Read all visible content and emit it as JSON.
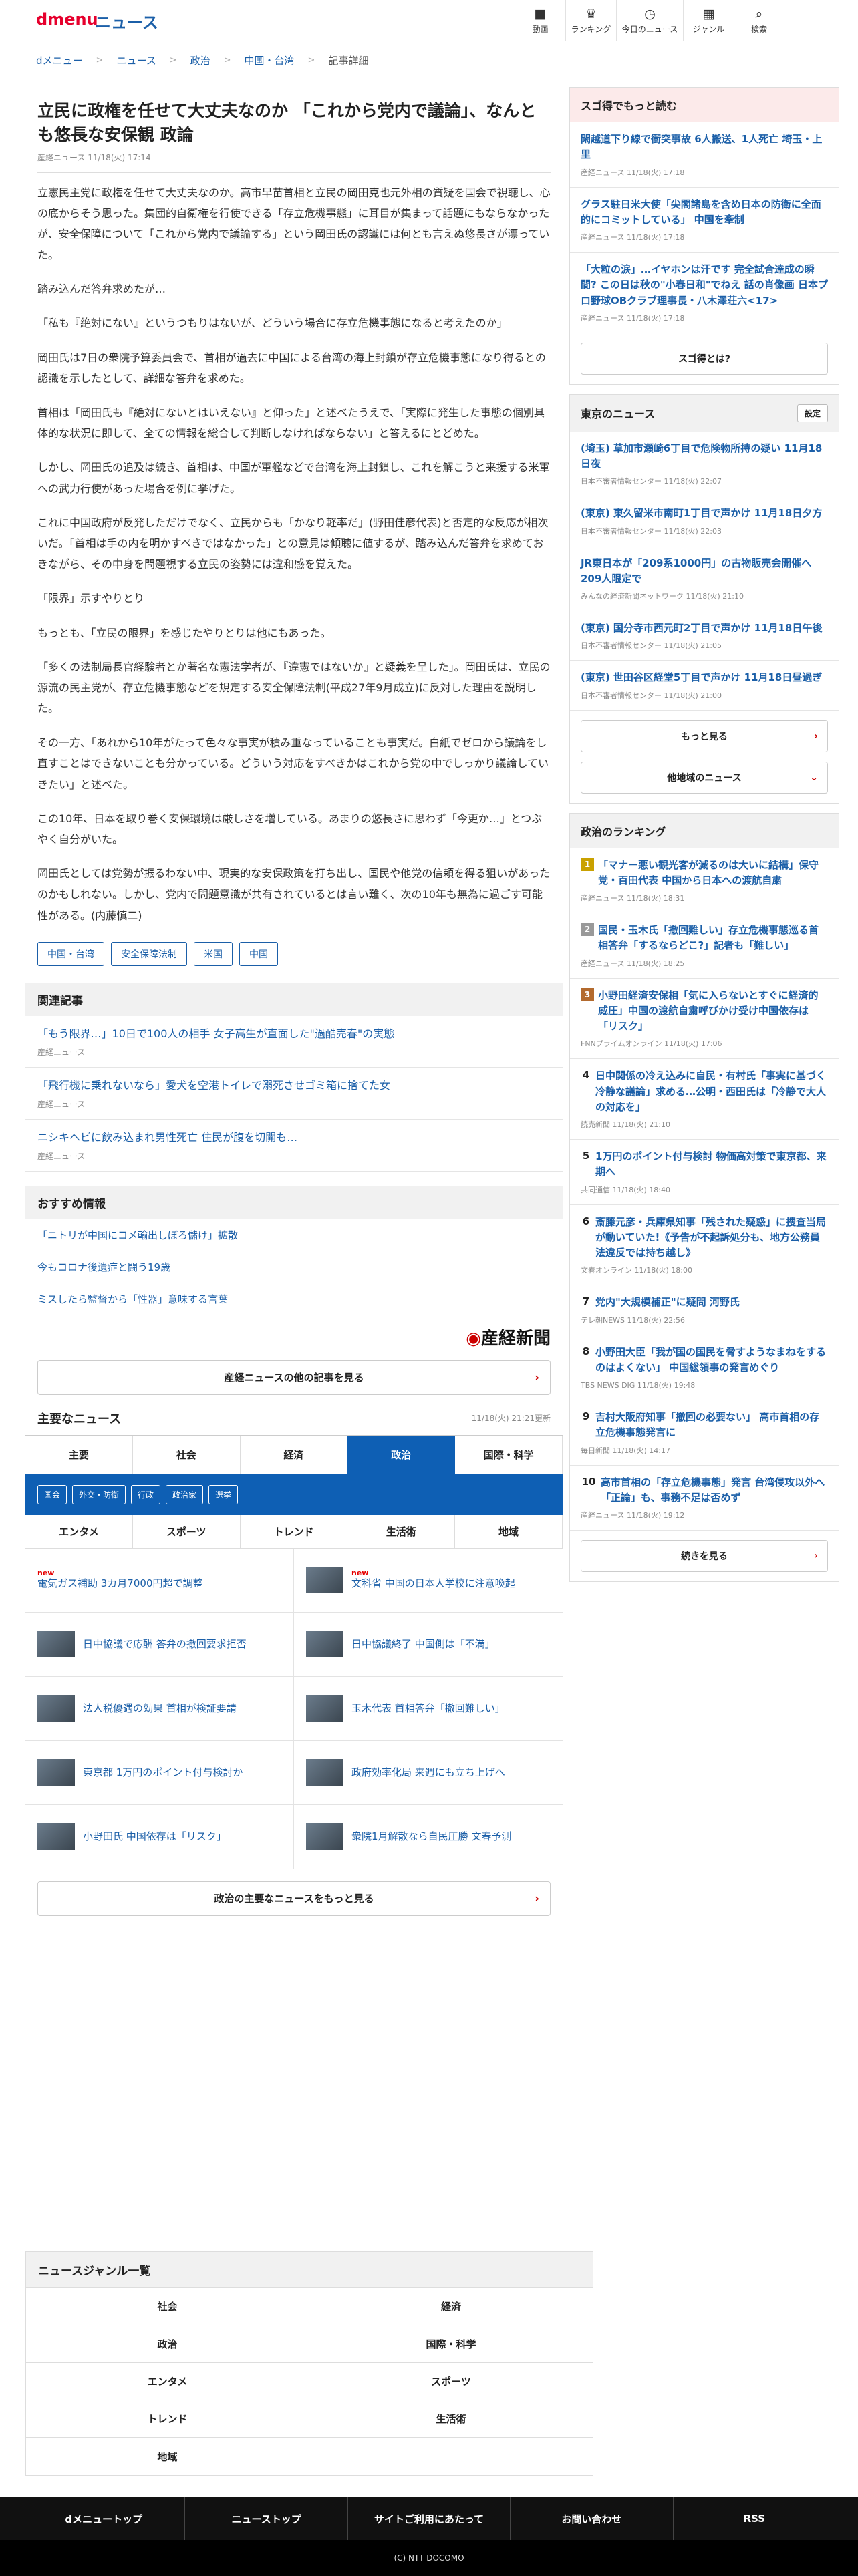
{
  "header": {
    "logo": "dmenu",
    "section": "ニュース",
    "nav": [
      {
        "label": "動画",
        "icon": "video-icon"
      },
      {
        "label": "ランキング",
        "icon": "trophy-icon"
      },
      {
        "label": "今日のニュース",
        "icon": "clock-icon"
      },
      {
        "label": "ジャンル",
        "icon": "grid-icon"
      },
      {
        "label": "検索",
        "icon": "search-icon"
      }
    ]
  },
  "breadcrumb": [
    "dメニュー",
    "ニュース",
    "政治",
    "中国・台湾",
    "記事詳細"
  ],
  "article": {
    "title": "立民に政権を任せて大丈夫なのか 「これから党内で議論」、なんとも悠長な安保観 政論",
    "source": "産経ニュース",
    "date": "11/18(火) 17:14",
    "paragraphs": [
      "立憲民主党に政権を任せて大丈夫なのか。高市早苗首相と立民の岡田克也元外相の質疑を国会で視聴し、心の底からそう思った。集団的自衛権を行使できる「存立危機事態」に耳目が集まって話題にもならなかったが、安全保障について「これから党内で議論する」という岡田氏の認識には何とも言えぬ悠長さが漂っていた。",
      "踏み込んだ答弁求めたが…",
      "「私も『絶対にない』というつもりはないが、どういう場合に存立危機事態になると考えたのか」",
      "岡田氏は7日の衆院予算委員会で、首相が過去に中国による台湾の海上封鎖が存立危機事態になり得るとの認識を示したとして、詳細な答弁を求めた。",
      "首相は「岡田氏も『絶対にないとはいえない』と仰った」と述べたうえで、「実際に発生した事態の個別具体的な状況に即して、全ての情報を総合して判断しなければならない」と答えるにとどめた。",
      "しかし、岡田氏の追及は続き、首相は、中国が軍艦などで台湾を海上封鎖し、これを解こうと来援する米軍への武力行使があった場合を例に挙げた。",
      "これに中国政府が反発しただけでなく、立民からも「かなり軽率だ」(野田佳彦代表)と否定的な反応が相次いだ。「首相は手の内を明かすべきではなかった」との意見は傾聴に値するが、踏み込んだ答弁を求めておきながら、その中身を問題視する立民の姿勢には違和感を覚えた。",
      "「限界」示すやりとり",
      "もっとも、「立民の限界」を感じたやりとりは他にもあった。",
      "「多くの法制局長官経験者とか著名な憲法学者が、『違憲ではないか』と疑義を呈した」。岡田氏は、立民の源流の民主党が、存立危機事態などを規定する安全保障法制(平成27年9月成立)に反対した理由を説明した。",
      "その一方、「あれから10年がたって色々な事実が積み重なっていることも事実だ。白紙でゼロから議論をし直すことはできないことも分かっている。どういう対応をすべきかはこれから党の中でしっかり議論していきたい」と述べた。",
      "この10年、日本を取り巻く安保環境は厳しさを増している。あまりの悠長さに思わず「今更か…」とつぶやく自分がいた。",
      "岡田氏としては党勢が振るわない中、現実的な安保政策を打ち出し、国民や他党の信頼を得る狙いがあったのかもしれない。しかし、党内で問題意識が共有されているとは言い難く、次の10年も無為に過ごす可能性がある。(内藤慎二)"
    ],
    "tags": [
      "中国・台湾",
      "安全保障法制",
      "米国",
      "中国"
    ]
  },
  "related": {
    "heading": "関連記事",
    "items": [
      {
        "title": "「もう限界…」10日で100人の相手 女子高生が直面した\"過酷売春\"の実態",
        "source": "産経ニュース"
      },
      {
        "title": "「飛行機に乗れないなら」愛犬を空港トイレで溺死させゴミ箱に捨てた女",
        "source": "産経ニュース"
      },
      {
        "title": "ニシキヘビに飲み込まれ男性死亡 住民が腹を切開も…",
        "source": "産経ニュース"
      }
    ]
  },
  "recommended": {
    "heading": "おすすめ情報",
    "items": [
      "「ニトリが中国にコメ輸出しぼろ儲け」拡散",
      "今もコロナ後遺症と闘う19歳",
      "ミスしたら監督から「性器」意味する言葉"
    ]
  },
  "sankei_logo": "産経新聞",
  "more_sankei": "産経ニュースの他の記事を見る",
  "major_news": {
    "heading": "主要なニュース",
    "updated": "11/18(火) 21:21更新",
    "tabs_row1": [
      "主要",
      "社会",
      "経済",
      "政治",
      "国際・科学"
    ],
    "active_tab": "政治",
    "subtabs": [
      "国会",
      "外交・防衛",
      "行政",
      "政治家",
      "選挙"
    ],
    "tabs_row2": [
      "エンタメ",
      "スポーツ",
      "トレンド",
      "生活術",
      "地域"
    ],
    "items": [
      {
        "title": "電気ガス補助 3カ月7000円超で調整",
        "new": "new"
      },
      {
        "title": "文科省 中国の日本人学校に注意喚起",
        "new": "new"
      },
      {
        "title": "日中協議で応酬 答弁の撤回要求拒否",
        "new": ""
      },
      {
        "title": "日中協議終了 中国側は「不満」",
        "new": ""
      },
      {
        "title": "法人税優遇の効果 首相が検証要請",
        "new": ""
      },
      {
        "title": "玉木代表 首相答弁「撤回難しい」",
        "new": ""
      },
      {
        "title": "東京都 1万円のポイント付与検討か",
        "new": ""
      },
      {
        "title": "政府効率化局 来週にも立ち上げへ",
        "new": ""
      },
      {
        "title": "小野田氏 中国依存は「リスク」",
        "new": ""
      },
      {
        "title": "衆院1月解散なら自民圧勝 文春予測",
        "new": ""
      }
    ],
    "more": "政治の主要なニュースをもっと見る"
  },
  "genres": {
    "heading": "ニュースジャンル一覧",
    "items": [
      "社会",
      "経済",
      "政治",
      "国際・科学",
      "エンタメ",
      "スポーツ",
      "トレンド",
      "生活術",
      "地域"
    ]
  },
  "sugotoku": {
    "heading": "スゴ得でもっと読む",
    "items": [
      {
        "title": "閑越道下り線で衝突事故 6人搬送、1人死亡 埼玉・上里",
        "source": "産経ニュース 11/18(火) 17:18"
      },
      {
        "title": "グラス駐日米大使「尖閣諸島を含め日本の防衛に全面的にコミットしている」 中国を牽制",
        "source": "産経ニュース 11/18(火) 17:18"
      },
      {
        "title": "「大粒の涙」…イヤホンは汗です 完全試合達成の瞬間? この日は秋の\"小春日和\"でねえ 話の肖像画 日本プロ野球OBクラブ理事長・八木澤荘六<17>",
        "source": "産経ニュース 11/18(火) 17:18"
      }
    ],
    "what": "スゴ得とは?"
  },
  "tokyo": {
    "heading": "東京のニュース",
    "setting": "設定",
    "items": [
      {
        "title": "(埼玉) 草加市瀬崎6丁目で危険物所持の疑い 11月18日夜",
        "source": "日本不審者情報センター 11/18(火) 22:07"
      },
      {
        "title": "(東京) 東久留米市南町1丁目で声かけ 11月18日夕方",
        "source": "日本不審者情報センター 11/18(火) 22:03"
      },
      {
        "title": "JR東日本が「209系1000円」の古物販売会開催へ 209人限定で",
        "source": "みんなの経済新聞ネットワーク 11/18(火) 21:10"
      },
      {
        "title": "(東京) 国分寺市西元町2丁目で声かけ 11月18日午後",
        "source": "日本不審者情報センター 11/18(火) 21:05"
      },
      {
        "title": "(東京) 世田谷区経堂5丁目で声かけ 11月18日昼過ぎ",
        "source": "日本不審者情報センター 11/18(火) 21:00"
      }
    ],
    "more": "もっと見る",
    "other": "他地域のニュース"
  },
  "ranking": {
    "heading": "政治のランキング",
    "items": [
      {
        "rank": "1",
        "title": "「マナー悪い観光客が減るのは大いに結構」保守党・百田代表 中国から日本への渡航自粛",
        "source": "産経ニュース 11/18(火) 18:31"
      },
      {
        "rank": "2",
        "title": "国民・玉木氏「撤回難しい」存立危機事態巡る首相答弁「するならどこ?」記者も「難しい」",
        "source": "産経ニュース 11/18(火) 18:25"
      },
      {
        "rank": "3",
        "title": "小野田経済安保相「気に入らないとすぐに経済的威圧」中国の渡航自粛呼びかけ受け中国依存は「リスク」",
        "source": "FNNプライムオンライン 11/18(火) 17:06"
      },
      {
        "rank": "4",
        "title": "日中関係の冷え込みに自民・有村氏「事実に基づく冷静な議論」求める…公明・西田氏は「冷静で大人の対応を」",
        "source": "読売新聞 11/18(火) 21:10"
      },
      {
        "rank": "5",
        "title": "1万円のポイント付与検討 物価高対策で東京都、来期へ",
        "source": "共同通信 11/18(火) 18:40"
      },
      {
        "rank": "6",
        "title": "斎藤元彦・兵庫県知事「残された疑惑」に捜査当局が動いていた!《予告が不起訴処分も、地方公務員法違反では持ち越し》",
        "source": "文春オンライン 11/18(火) 18:00"
      },
      {
        "rank": "7",
        "title": "党内\"大規模補正\"に疑問 河野氏",
        "source": "テレ朝NEWS 11/18(火) 22:56"
      },
      {
        "rank": "8",
        "title": "小野田大臣「我が国の国民を脅すようなまねをするのはよくない」 中国総領事の発言めぐり",
        "source": "TBS NEWS DIG 11/18(火) 19:48"
      },
      {
        "rank": "9",
        "title": "吉村大阪府知事「撤回の必要ない」 高市首相の存立危機事態発言に",
        "source": "毎日新聞 11/18(火) 14:17"
      },
      {
        "rank": "10",
        "title": "高市首相の「存立危機事態」発言 台湾侵攻以外へ「正論」も、事務不足は否めず",
        "source": "産経ニュース 11/18(火) 19:12"
      }
    ],
    "more": "続きを見る"
  },
  "footer": {
    "links": [
      "dメニュートップ",
      "ニューストップ",
      "サイトご利用にあたって",
      "お問い合わせ",
      "RSS"
    ],
    "copyright": "(C) NTT DOCOMO"
  }
}
